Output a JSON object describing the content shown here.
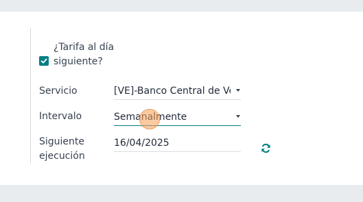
{
  "form": {
    "next_day_rate": {
      "label_line1": "¿Tarifa al día",
      "label_line2": "siguiente?",
      "checked": true
    },
    "service": {
      "label": "Servicio",
      "value": "[VE]-Banco Central de Venezuela"
    },
    "interval": {
      "label": "Intervalo",
      "value": "Semanalmente"
    },
    "next_execution": {
      "label_line1": "Siguiente",
      "label_line2": "ejecución",
      "value": "16/04/2025"
    }
  },
  "icons": {
    "checkbox": "check-icon",
    "dropdown": "caret-down-icon",
    "refresh": "refresh-icon"
  },
  "colors": {
    "accent": "#017e84",
    "page_bg": "#e9ecef",
    "panel_bg": "#ffffff"
  }
}
